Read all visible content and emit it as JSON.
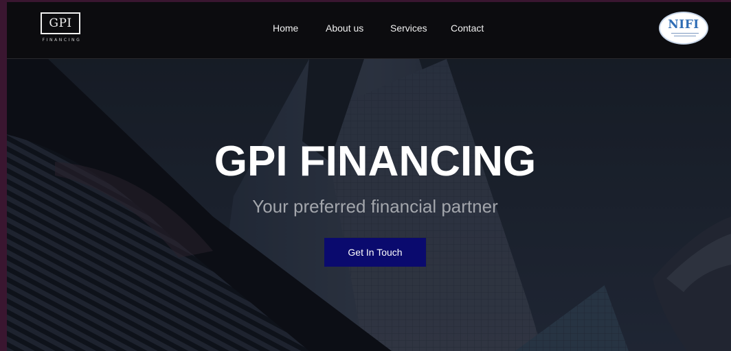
{
  "header": {
    "logo_text": "GPI",
    "logo_subtext": "FINANCING",
    "nav": [
      {
        "label": "Home"
      },
      {
        "label": "About us"
      },
      {
        "label": "Services"
      },
      {
        "label": "Contact"
      }
    ],
    "badge_text": "NIFI"
  },
  "hero": {
    "title": "GPI FINANCING",
    "subtitle": "Your preferred financial partner",
    "cta_label": "Get In Touch"
  },
  "colors": {
    "page_background": "#3a1630",
    "navbar": "#0c0c0f",
    "cta_background": "#0a0a6e",
    "badge_text": "#2f6db5"
  }
}
